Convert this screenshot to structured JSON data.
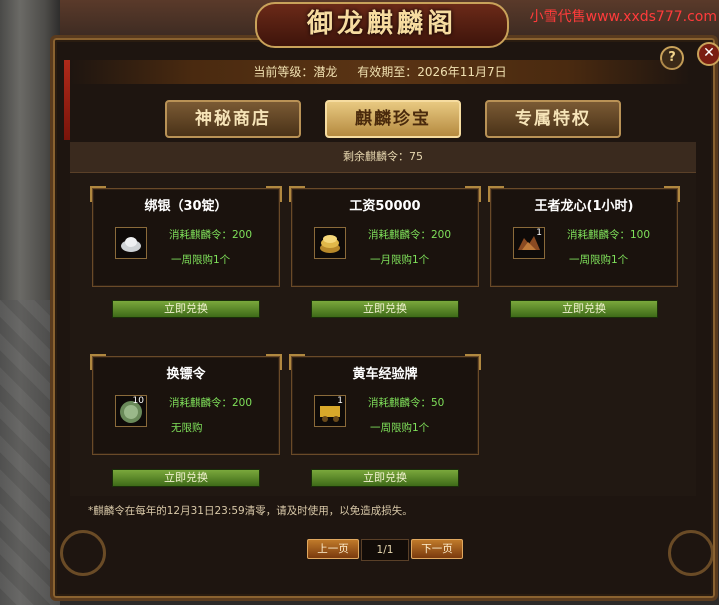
{
  "watermark": "小雪代售www.xxds777.com",
  "window": {
    "title": "御龙麒麟阁",
    "help": "?",
    "close": "✕"
  },
  "info": {
    "level_label": "当前等级：潜龙",
    "expire_label": "有效期至：2026年11月7日"
  },
  "tabs": [
    {
      "label": "神秘商店",
      "active": false
    },
    {
      "label": "麒麟珍宝",
      "active": true
    },
    {
      "label": "专属特权",
      "active": false
    }
  ],
  "remaining": "剩余麒麟令：75",
  "items": [
    {
      "title": "绑银（30锭）",
      "cost": "消耗麒麟令：200",
      "limit": "一周限购1个",
      "count": "",
      "icon": "silver-ingot-icon",
      "button": "立即兑换"
    },
    {
      "title": "工资50000",
      "cost": "消耗麒麟令：200",
      "limit": "一月限购1个",
      "count": "",
      "icon": "gold-coins-icon",
      "button": "立即兑换"
    },
    {
      "title": "王者龙心(1小时)",
      "cost": "消耗麒麟令：100",
      "limit": "一周限购1个",
      "count": "1",
      "icon": "dragon-heart-icon",
      "button": "立即兑换"
    },
    {
      "title": "换镖令",
      "cost": "消耗麒麟令：200",
      "limit": "无限购",
      "count": "10",
      "icon": "escort-token-icon",
      "button": "立即兑换"
    },
    {
      "title": "黄车经验牌",
      "cost": "消耗麒麟令：50",
      "limit": "一周限购1个",
      "count": "1",
      "icon": "yellow-cart-icon",
      "button": "立即兑换"
    }
  ],
  "note": "*麒麟令在每年的12月31日23:59清零，请及时使用，以免造成损失。",
  "pager": {
    "prev": "上一页",
    "page": "1/1",
    "next": "下一页"
  },
  "colors": {
    "accent": "#c9a25a",
    "green_text": "#7fe05a",
    "button_green": "#5a8a2a"
  }
}
